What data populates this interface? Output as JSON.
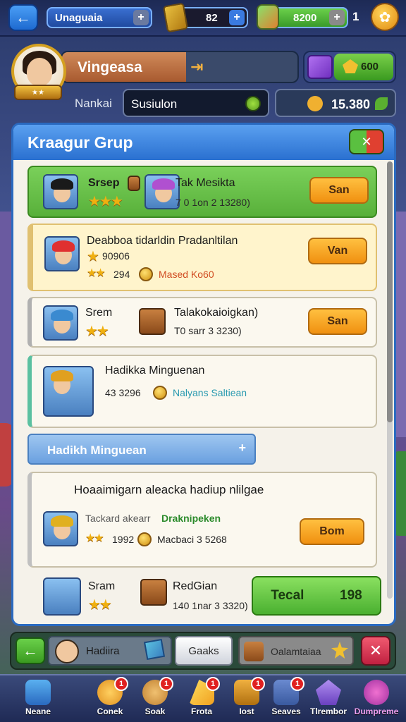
{
  "topbar": {
    "back_icon": "arrow-left-icon",
    "name_field": "Unaguaia",
    "gold": "82",
    "gems": "8200",
    "count": "1",
    "coin_icon": "coin-icon"
  },
  "profile": {
    "name": "Vingeasa",
    "rank_label": "Nankai",
    "rank_value": "Susiulon",
    "gem_amount": "600",
    "coins": "15.380"
  },
  "panel": {
    "title": "Kraagur Grup",
    "cards": [
      {
        "title": "Srsep",
        "right_title": "Tak Mesikta",
        "sub": "7 0 1on 2 13280)",
        "button": "San"
      },
      {
        "title": "Deabboa tidarldin Pradanltilan",
        "code": "90906",
        "stars_text": "294",
        "tag": "Mased Ko60",
        "button": "Van"
      },
      {
        "title": "Srem",
        "right_title": "Talakokaioigkan)",
        "sub": "T0 sarr 3 3230)",
        "button": "San"
      },
      {
        "title": "Hadikka Minguenan",
        "code": "43 3296",
        "tag": "Nalyans Saltiean"
      }
    ],
    "section": "Hadikh Minguean",
    "card5": {
      "title": "Hoaaimigarn aleacka hadiup nlilgae",
      "sub_left": "Tackard akearr",
      "sub_right": "Draknipeken",
      "code": "1992",
      "right_code": "Macbaci 3 5268",
      "button": "Bom"
    },
    "card6": {
      "title": "Sram",
      "right_title": "RedGian",
      "sub": "140 1nar 3 3320)",
      "button_left": "Tecal",
      "button_right": "198"
    }
  },
  "actionbar": {
    "field": "Hadiira",
    "mid": "Gaaks",
    "field2": "Oalamtaiaa"
  },
  "nav": [
    {
      "label": "Neane",
      "icon": "home-icon"
    },
    {
      "label": "Conek",
      "icon": "smile-icon",
      "badge": "1"
    },
    {
      "label": "Soak",
      "icon": "cookie-icon",
      "badge": "1"
    },
    {
      "label": "Frota",
      "icon": "cheese-icon",
      "badge": "1"
    },
    {
      "label": "Iost",
      "icon": "box-icon",
      "badge": "1"
    },
    {
      "label": "Seaves",
      "icon": "backpack-icon",
      "badge": "1"
    },
    {
      "label": "Tlrembor",
      "icon": "gem-icon"
    },
    {
      "label": "Dumpreme",
      "icon": "potion-icon"
    }
  ],
  "colors": {
    "accent": "#2a70d0",
    "claim": "#f09010",
    "success": "#4ab030",
    "danger": "#c02040"
  }
}
